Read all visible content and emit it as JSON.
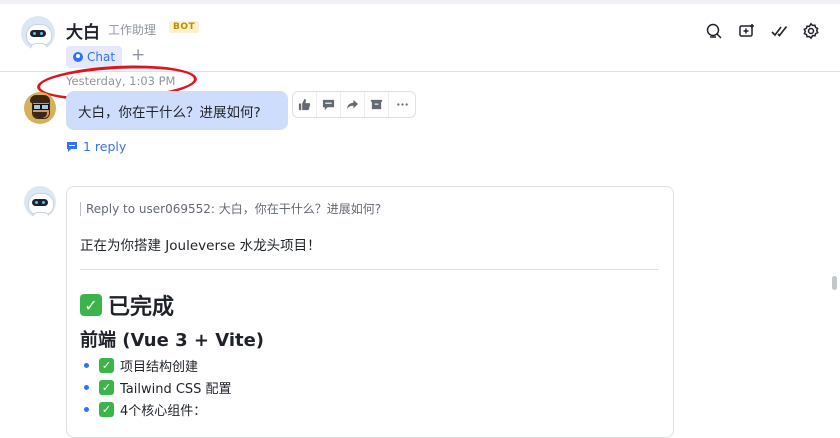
{
  "header": {
    "title": "大白",
    "subtitle": "工作助理",
    "badge": "BOT",
    "tabs": [
      {
        "label": "Chat"
      }
    ],
    "add_tab": "+",
    "icons": [
      "search-icon",
      "add-to-chat-icon",
      "checkmark-icon",
      "settings-icon"
    ]
  },
  "timestamp": "Yesterday, 1:03 PM",
  "message1": {
    "text": "大白，你在干什么？进展如何?",
    "actions": [
      "thumbs-up-icon",
      "comment-icon",
      "forward-icon",
      "save-icon",
      "more-icon"
    ],
    "reply_count": "1 reply"
  },
  "message2": {
    "quote": "Reply to user069552: 大白，你在干什么？进展如何?",
    "intro": "正在为你搭建 Jouleverse 水龙头项目！",
    "section_title": "已完成",
    "subsection_title": "前端 (Vue 3 + Vite)",
    "items": [
      {
        "text": "项目结构创建"
      },
      {
        "text": "Tailwind CSS 配置"
      },
      {
        "text": "4个核心组件："
      }
    ]
  },
  "colors": {
    "accent": "#3370ff",
    "bubble": "#cfddfc",
    "annotation": "#e0141e",
    "success": "#3bb54a"
  }
}
